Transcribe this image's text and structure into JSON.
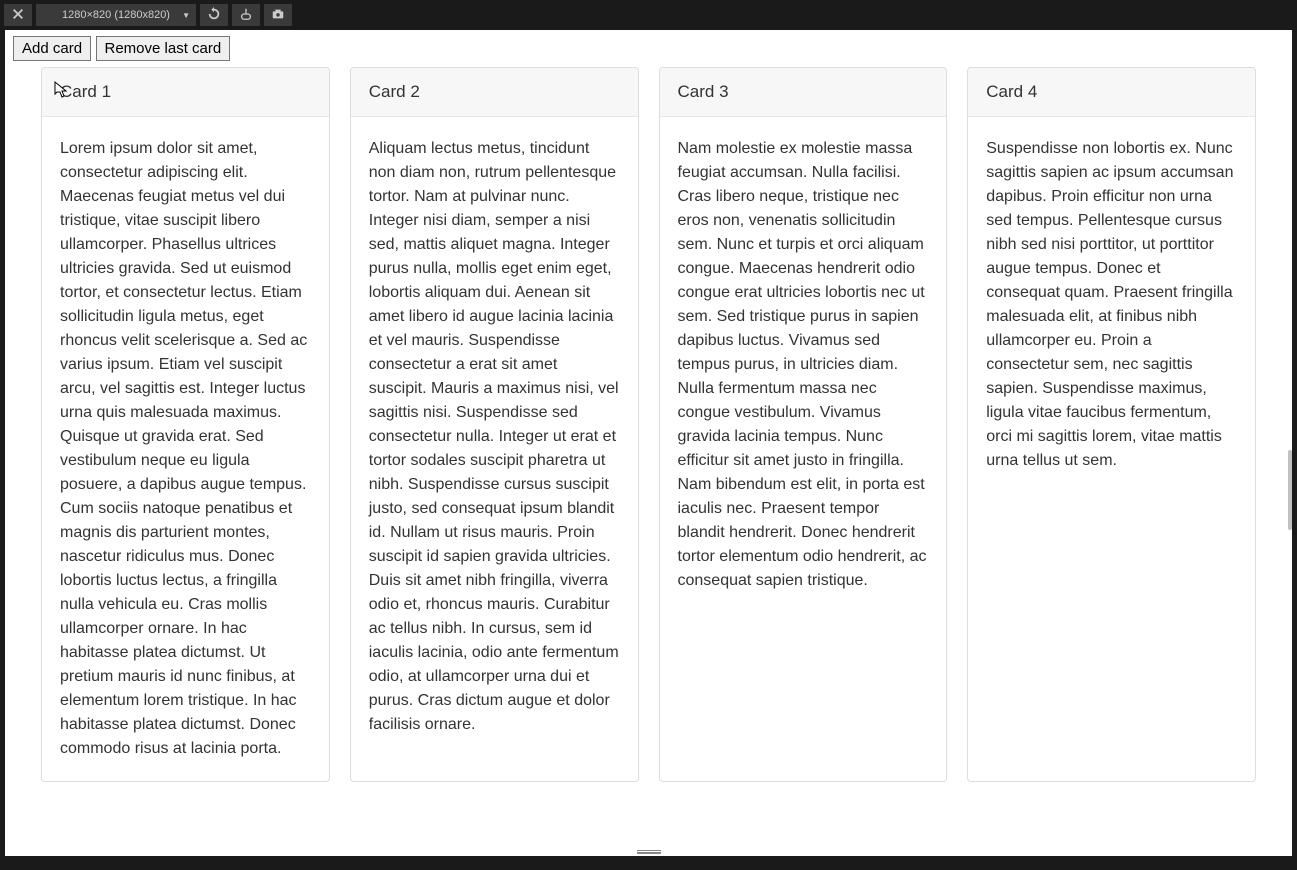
{
  "devtools": {
    "resolution_label": "1280×820 (1280x820)"
  },
  "buttons": {
    "add": "Add card",
    "remove": "Remove last card"
  },
  "cards": [
    {
      "title": "Card 1",
      "body": "Lorem ipsum dolor sit amet, consectetur adipiscing elit. Maecenas feugiat metus vel dui tristique, vitae suscipit libero ullamcorper. Phasellus ultrices ultricies gravida. Sed ut euismod tortor, et consectetur lectus. Etiam sollicitudin ligula metus, eget rhoncus velit scelerisque a. Sed ac varius ipsum. Etiam vel suscipit arcu, vel sagittis est. Integer luctus urna quis malesuada maximus. Quisque ut gravida erat. Sed vestibulum neque eu ligula posuere, a dapibus augue tempus. Cum sociis natoque penatibus et magnis dis parturient montes, nascetur ridiculus mus. Donec lobortis luctus lectus, a fringilla nulla vehicula eu. Cras mollis ullamcorper ornare. In hac habitasse platea dictumst. Ut pretium mauris id nunc finibus, at elementum lorem tristique. In hac habitasse platea dictumst. Donec commodo risus at lacinia porta."
    },
    {
      "title": "Card 2",
      "body": "Aliquam lectus metus, tincidunt non diam non, rutrum pellentesque tortor. Nam at pulvinar nunc. Integer nisi diam, semper a nisi sed, mattis aliquet magna. Integer purus nulla, mollis eget enim eget, lobortis aliquam dui. Aenean sit amet libero id augue lacinia lacinia et vel mauris. Suspendisse consectetur a erat sit amet suscipit. Mauris a maximus nisi, vel sagittis nisi. Suspendisse sed consectetur nulla. Integer ut erat et tortor sodales suscipit pharetra ut nibh. Suspendisse cursus suscipit justo, sed consequat ipsum blandit id. Nullam ut risus mauris. Proin suscipit id sapien gravida ultricies. Duis sit amet nibh fringilla, viverra odio et, rhoncus mauris. Curabitur ac tellus nibh. In cursus, sem id iaculis lacinia, odio ante fermentum odio, at ullamcorper urna dui et purus. Cras dictum augue et dolor facilisis ornare."
    },
    {
      "title": "Card 3",
      "body": "Nam molestie ex molestie massa feugiat accumsan. Nulla facilisi. Cras libero neque, tristique nec eros non, venenatis sollicitudin sem. Nunc et turpis et orci aliquam congue. Maecenas hendrerit odio congue erat ultricies lobortis nec ut sem. Sed tristique purus in sapien dapibus luctus. Vivamus sed tempus purus, in ultricies diam. Nulla fermentum massa nec congue vestibulum. Vivamus gravida lacinia tempus. Nunc efficitur sit amet justo in fringilla. Nam bibendum est elit, in porta est iaculis nec. Praesent tempor blandit hendrerit. Donec hendrerit tortor elementum odio hendrerit, ac consequat sapien tristique."
    },
    {
      "title": "Card 4",
      "body": "Suspendisse non lobortis ex. Nunc sagittis sapien ac ipsum accumsan dapibus. Proin efficitur non urna sed tempus. Pellentesque cursus nibh sed nisi porttitor, ut porttitor augue tempus. Donec et consequat quam. Praesent fringilla malesuada elit, at finibus nibh ullamcorper eu. Proin a consectetur sem, nec sagittis sapien. Suspendisse maximus, ligula vitae faucibus fermentum, orci mi sagittis lorem, vitae mattis urna tellus ut sem."
    }
  ]
}
